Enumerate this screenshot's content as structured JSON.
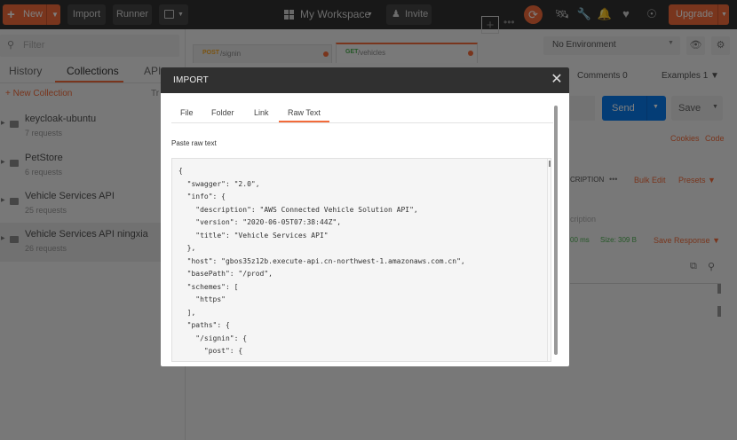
{
  "header": {
    "new_label": "New",
    "import_label": "Import",
    "runner_label": "Runner",
    "workspace_label": "My Workspace",
    "invite_label": "Invite",
    "upgrade_label": "Upgrade",
    "accent_color": "#f26b3a"
  },
  "sidebar": {
    "filter_placeholder": "Filter",
    "tabs": [
      "History",
      "Collections",
      "APIs"
    ],
    "active_tab": "Collections",
    "new_collection_label": "New Collection",
    "trash_label": "Tr",
    "collections": [
      {
        "name": "keycloak-ubuntu",
        "count": "7 requests"
      },
      {
        "name": "PetStore",
        "count": "6 requests"
      },
      {
        "name": "Vehicle Services API",
        "count": "25 requests"
      },
      {
        "name": "Vehicle Services API ningxia",
        "count": "26 requests"
      }
    ]
  },
  "main": {
    "request_tabs": [
      {
        "method": "POST",
        "url": "/signin",
        "method_color": "#f5a623"
      },
      {
        "method": "GET",
        "url": "/vehicles",
        "method_color": "#4caf50"
      }
    ],
    "environment": "No Environment",
    "comments_label": "Comments",
    "comments_count": "0",
    "examples_label": "Examples",
    "examples_count": "1",
    "send_label": "Send",
    "save_label": "Save",
    "cookies_label": "Cookies",
    "code_label": "Code",
    "description_label": "CRIPTION",
    "bulk_edit_label": "Bulk Edit",
    "presets_label": "Presets",
    "description_placeholder": "cription",
    "time_label": "00 ms",
    "size_label": "Size: 309 B",
    "save_response_label": "Save Response"
  },
  "modal": {
    "title": "IMPORT",
    "tabs": [
      "File",
      "Folder",
      "Link",
      "Raw Text"
    ],
    "active_tab": "Raw Text",
    "paste_label": "Paste raw text",
    "raw_text": "{\n  \"swagger\": \"2.0\",\n  \"info\": {\n    \"description\": \"AWS Connected Vehicle Solution API\",\n    \"version\": \"2020-06-05T07:38:44Z\",\n    \"title\": \"Vehicle Services API\"\n  },\n  \"host\": \"gbos35z12b.execute-api.cn-northwest-1.amazonaws.com.cn\",\n  \"basePath\": \"/prod\",\n  \"schemes\": [\n    \"https\"\n  ],\n  \"paths\": {\n    \"/signin\": {\n      \"post\": {"
  }
}
